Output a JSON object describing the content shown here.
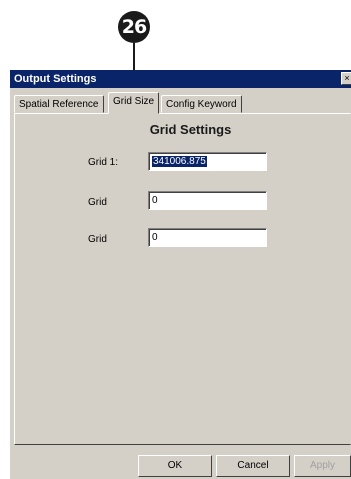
{
  "callout": {
    "number": "26"
  },
  "window": {
    "title": "Output Settings",
    "close_glyph": "×"
  },
  "tabs": [
    {
      "label": "Spatial Reference",
      "selected": false
    },
    {
      "label": "Grid Size",
      "selected": true
    },
    {
      "label": "Config Keyword",
      "selected": false
    }
  ],
  "panel": {
    "heading": "Grid Settings",
    "fields": [
      {
        "label": "Grid 1:",
        "value": "341006.875"
      },
      {
        "label": "Grid",
        "value": "0"
      },
      {
        "label": "Grid",
        "value": "0"
      }
    ]
  },
  "buttons": {
    "ok": "OK",
    "cancel": "Cancel",
    "apply": "Apply"
  },
  "colors": {
    "titlebar": "#0a246a",
    "face": "#d4d0c8",
    "callout": "#1a1a1a"
  }
}
